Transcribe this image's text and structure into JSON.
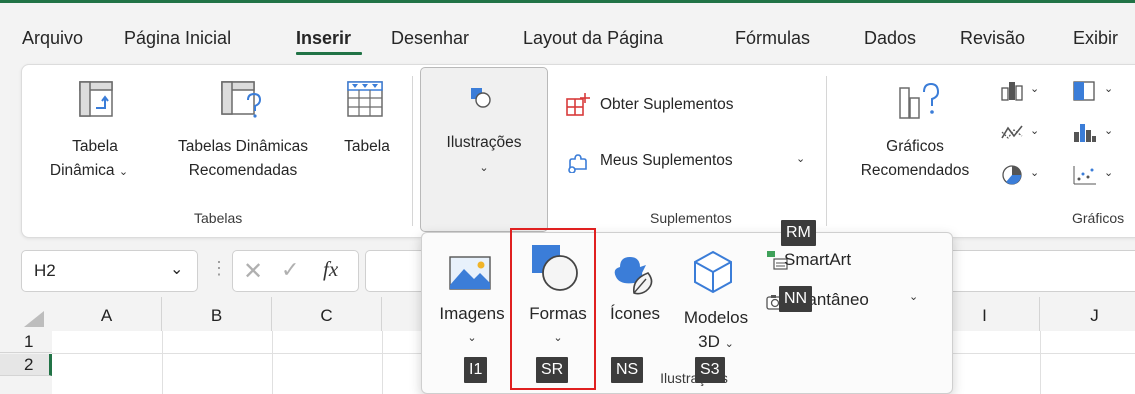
{
  "menu_tabs": [
    "Arquivo",
    "Página Inicial",
    "Inserir",
    "Desenhar",
    "Layout da Página",
    "Fórmulas",
    "Dados",
    "Revisão",
    "Exibir"
  ],
  "active_tab": "Inserir",
  "ribbon": {
    "tabela_dinamica": [
      "Tabela",
      "Dinâmica"
    ],
    "tabelas_recomendadas": [
      "Tabelas Dinâmicas",
      "Recomendadas"
    ],
    "tabela": "Tabela",
    "tabelas_group": "Tabelas",
    "ilustracoes": "Ilustrações",
    "obter_suplementos": "Obter Suplementos",
    "meus_suplementos": "Meus Suplementos",
    "suplementos_group": "Suplementos",
    "graficos_recomendados": [
      "Gráficos",
      "Recomendados"
    ],
    "graficos_group": "Gráficos"
  },
  "formula_bar": {
    "name_box": "H2",
    "fx": "fx"
  },
  "columns": [
    "A",
    "B",
    "C",
    "I",
    "J"
  ],
  "rows": [
    "1",
    "2"
  ],
  "dropdown": {
    "imagens": "Imagens",
    "formas": "Formas",
    "icones": "Ícones",
    "modelos3d": [
      "Modelos",
      "3D"
    ],
    "smartart": "SmartArt",
    "instantaneo": "Instantâneo",
    "group_label": "Ilustrações"
  },
  "keytips": {
    "rm": "RM",
    "nn": "NN",
    "i1": "I1",
    "sr": "SR",
    "ns": "NS",
    "s3": "S3"
  },
  "colors": {
    "accent": "#217346",
    "highlight": "#e02020",
    "keytip_bg": "#3c3c3c",
    "icon_blue": "#3b7dd8"
  }
}
